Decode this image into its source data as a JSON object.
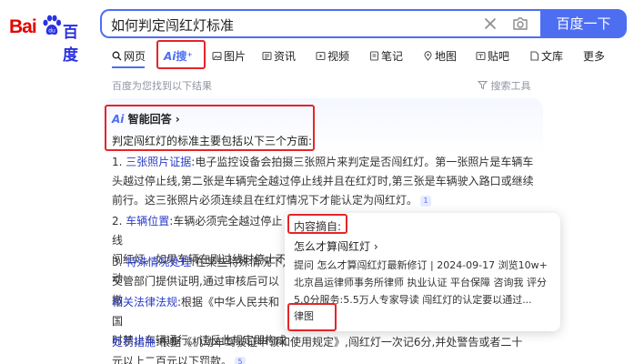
{
  "logo": {
    "left": "Bai",
    "right": "百度"
  },
  "search": {
    "query": "如何判定闯红灯标准",
    "button": "百度一下"
  },
  "tabs": [
    {
      "label": "网页"
    },
    {
      "label": "搜⁺",
      "ai_prefix": "Ai"
    },
    {
      "label": "图片"
    },
    {
      "label": "资讯"
    },
    {
      "label": "视频"
    },
    {
      "label": "笔记"
    },
    {
      "label": "地图"
    },
    {
      "label": "贴吧"
    },
    {
      "label": "文库"
    },
    {
      "label": "更多"
    }
  ],
  "results": {
    "count_text": "百度为您找到以下结果",
    "tools_label": "搜索工具"
  },
  "ai_answer": {
    "title_prefix": "Ai",
    "title": "智能回答",
    "intro": "判定闯红灯的标准主要包括以下三个方面:",
    "items": [
      {
        "num": "1.",
        "head": "三张照片证据",
        "body": ":电子监控设备会拍摄三张照片来判定是否闯红灯。第一张照片是车辆车头越过停止线,第二张是车辆完全越过停止线并且在红灯时,第三张是车辆驶入路口或继续前行。这三张照片必须连续且在红灯情况下才能认定为闯红灯。",
        "ref": "1"
      },
      {
        "num": "2.",
        "head": "车辆位置",
        "body": ":车辆必须完全越过停止线",
        "line2": "闯红灯。如果车辆在刚过线时停止不动"
      },
      {
        "num": "3.",
        "head": "特殊情况处理",
        "body": ":在某些特殊情况下,",
        "line2": "交管部门提供证明,通过审核后可以撤"
      },
      {
        "head": "相关法律法规",
        "body": ":根据《中华人民共和国",
        "line2": "时禁止车辆通行。违反此规定即构成"
      },
      {
        "head": "处罚措施",
        "body": ":根据《机动车驾驶证申领和使用规定》,闯红灯一次记6分,并处警告或者二十",
        "line2": "元以上二百元以下罚款。",
        "ref": "5"
      }
    ]
  },
  "popup": {
    "label": "内容摘自:",
    "link": "怎么才算闯红灯",
    "text": "提问 怎么才算闯红灯最新修订 | 2024-09-17 浏览10w+ 北京昌运律师事务所律师 执业认证 平台保障 咨询我 评分5.0分服务:5.5万人专家导读 闯红灯的认定要以通过...",
    "footer": "律图"
  },
  "colors": {
    "accent": "#4e6ef2",
    "highlight_box": "#e52528",
    "logo_red": "#e10601",
    "logo_blue": "#2932e1"
  }
}
